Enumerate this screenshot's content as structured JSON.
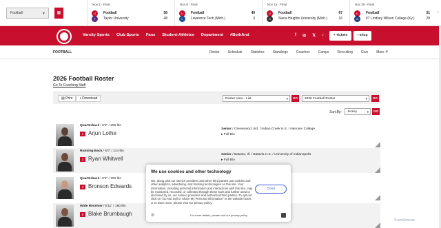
{
  "scoreboard": {
    "sport_select": "Football",
    "games": [
      {
        "date": "Nov 1 - Final",
        "team1": "Football",
        "score1": "56",
        "team2": "Taylor University",
        "score2": "48"
      },
      {
        "date": "Nov 8 - Final",
        "team1": "Football",
        "score1": "49",
        "team2": "Lawrence Tech (Mich.)",
        "score2": "3"
      },
      {
        "date": "Nov 15 - Final",
        "team1": "Football",
        "score1": "67",
        "team2": "Siena Heights University (Mich.)",
        "score2": "16"
      },
      {
        "date": "Nov 29 - Final",
        "team1": "Football",
        "score1": "31",
        "team2": "#7 Lindsey Wilson College (Ky.)",
        "score2": "28"
      }
    ]
  },
  "header": {
    "nav": [
      "Varsity Sports",
      "Club Sports",
      "Fans",
      "Student-Athletes",
      "Department",
      "#BothAnd"
    ],
    "social": [
      "f",
      "◎",
      "𝕏",
      "♪",
      "▶"
    ],
    "tickets": "+ Tickets",
    "shop": "Shop"
  },
  "subnav": {
    "title": "FOOTBALL",
    "links": [
      "Roster",
      "Schedule",
      "Statistics",
      "Standings",
      "Coaches",
      "Camps",
      "Recruiting",
      "Give",
      "More +"
    ]
  },
  "page": {
    "title": "2026 Football Roster",
    "coaching_link": "Go To Coaching Staff",
    "print": "Print",
    "download": "Download",
    "view_select": "Roster View - List",
    "season_select": "2026 Football Roster",
    "go": "GO",
    "sort_label": "Sort By:",
    "sort_select": "Jersey"
  },
  "roster": [
    {
      "position": "Quarterback",
      "details": "/ 6'3\" / 205 lbs",
      "number": "1",
      "name": "Arjun Lothe",
      "class": "Senior",
      "hometown": "/ Greenwood, Ind. / Indian Creek H.S. / Hanover College",
      "bio": "▸ Full Bio"
    },
    {
      "position": "Running Back",
      "details": "/ 6'0\" / 214 lbs",
      "number": "2",
      "name": "Ryan Whitwell",
      "class": "Senior",
      "hometown": "/ Batavia, Ill. / Batavia H.S. / University of Indianapolis",
      "bio": "▸ Full Bio"
    },
    {
      "position": "Quarterback",
      "details": "/ 6'2\" / 190 lbs",
      "number": "4",
      "name": "Bronson Edwards",
      "class": "",
      "hometown": "",
      "bio": ""
    },
    {
      "position": "Wide Receiver",
      "details": "/ 5'11\" / 180 lbs",
      "number": "8",
      "name": "Blake Brumbaugh",
      "class": "",
      "hometown": "",
      "bio": ""
    }
  ],
  "cookie": {
    "title": "We use cookies and other technology",
    "body": "We, along with our service providers and other third parties use cookies and other analytics, advertising, and tracking technologies on this site. Your information, including personal information and interactions with this site, may be monitored, recorded, or collected through these tools and further used or disclosed by us, our service providers and authorized third parties. To opt-out click on \"Do Not Sell or Share My Personal Information\" in the website footer, or to learn more, please visit our privacy policy.",
    "close": "Close",
    "footer": "For more details, please visit our privacy policy."
  },
  "watermark": "ScanMalware",
  "colors": {
    "brand": "#c8102e"
  }
}
